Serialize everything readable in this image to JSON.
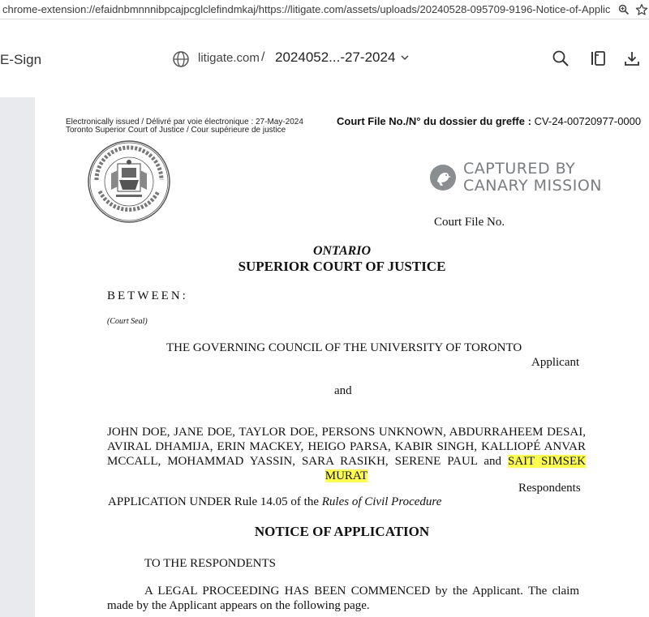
{
  "browser": {
    "url": "chrome-extension://efaidnbmnnnibpcajpcglclefindmkaj/https://litigate.com/assets/uploads/20240528-095709-9196-Notice-of-Application-U-of-..."
  },
  "toolbar": {
    "esign_label": "E-Sign",
    "domain": "litigate.com",
    "separator": "/",
    "filename": "2024052...-27-2024"
  },
  "document": {
    "issued_line1": "Electronically issued / Délivré par voie électronique : 27-May-2024",
    "issued_line2": "Toronto Superior Court of Justice / Cour supérieure de justice",
    "court_file_label": "Court File No./N° du dossier du greffe :",
    "court_file_number": "CV-24-00720977-0000",
    "watermark_line1": "CAPTURED BY",
    "watermark_line2": "CANARY MISSION",
    "court_file_no": "Court File No.",
    "province": "ONTARIO",
    "court": "SUPERIOR COURT OF JUSTICE",
    "between": "BETWEEN:",
    "court_seal": "(Court Seal)",
    "applicant_name": "THE GOVERNING COUNCIL OF THE UNIVERSITY OF TORONTO",
    "applicant_role": "Applicant",
    "and": "and",
    "respondents_text": "JOHN DOE, JANE DOE, TAYLOR DOE, PERSONS UNKNOWN, ABDURRAHEEM DESAI, AVIRAL DHAMIJA, ERIN MACKEY, HEIGO PARSA, KABIR SINGH, KALLIOPÉ ANVAR MCCALL, MOHAMMAD YASSIN, SARA RASIKH, SERENE PAUL and",
    "respondents_highlight": "SAIT SIMSEK MURAT",
    "respondents_role": "Respondents",
    "application_under": "APPLICATION UNDER Rule 14.05 of the",
    "rules_title": "Rules of Civil Procedure",
    "notice_title": "NOTICE OF APPLICATION",
    "to_respondents": "TO THE RESPONDENTS",
    "legal_line1": "A LEGAL PROCEEDING HAS BEEN COMMENCED by the Applicant.  The claim",
    "legal_line2": "made by the Applicant appears on the following page."
  }
}
